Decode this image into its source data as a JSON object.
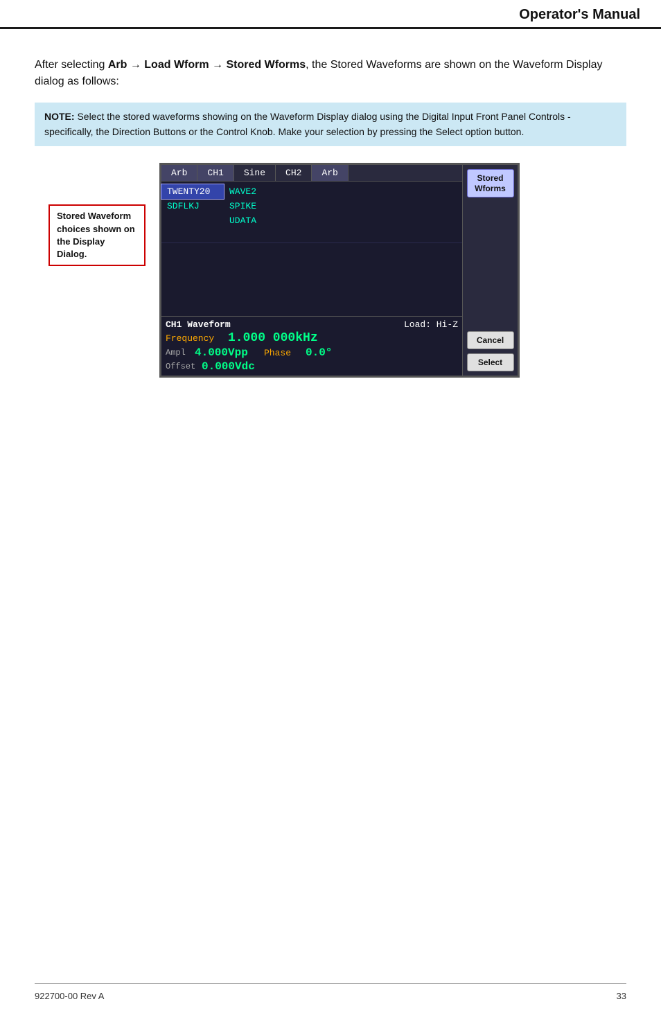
{
  "header": {
    "title": "Operator's Manual"
  },
  "intro": {
    "text_before_bold": "After selecting ",
    "bold_path": "Arb → Load Wform → Stored Wforms",
    "text_after_bold": ", the Stored Waveforms are shown on the Waveform Display dialog as follows:"
  },
  "note": {
    "label": "NOTE:",
    "text": " Select the stored waveforms showing on the Waveform Display dialog using the Digital Input Front Panel Controls - specifically, the Direction Buttons or the Control Knob. Make your selection by pressing the Select option button."
  },
  "label_box": {
    "line1": "Stored Waveform",
    "line2": "choices shown on",
    "line3": "the Display Dialog."
  },
  "device": {
    "tabs": [
      {
        "label": "Arb",
        "active": true
      },
      {
        "label": "CH1",
        "active": false
      },
      {
        "label": "Sine",
        "active": false
      },
      {
        "label": "CH2",
        "active": false
      },
      {
        "label": "Arb",
        "active": true
      }
    ],
    "waveform_rows": [
      {
        "col1": "TWENTY20",
        "col2": "WAVE2",
        "col1_selected": true
      },
      {
        "col1": "SDFLKJ",
        "col2": "SPIKE",
        "col1_selected": false
      },
      {
        "col1": "",
        "col2": "UDATA",
        "col1_selected": false
      },
      {
        "col1": "",
        "col2": "",
        "col1_selected": false
      }
    ],
    "ch1_label": "CH1 Waveform",
    "load_label": "Load: Hi-Z",
    "frequency_label": "Frequency",
    "frequency_value": "1.000 000kHz",
    "ampl_label": "Ampl",
    "ampl_value": "4.000Vpp",
    "phase_label": "Phase",
    "phase_value": "0.0°",
    "offset_label": "Offset",
    "offset_value": "0.000Vdc",
    "buttons": {
      "stored_wforms_label": "Stored\nWforms",
      "cancel_label": "Cancel",
      "select_label": "Select"
    }
  },
  "footer": {
    "left": "922700-00 Rev A",
    "right": "33"
  }
}
